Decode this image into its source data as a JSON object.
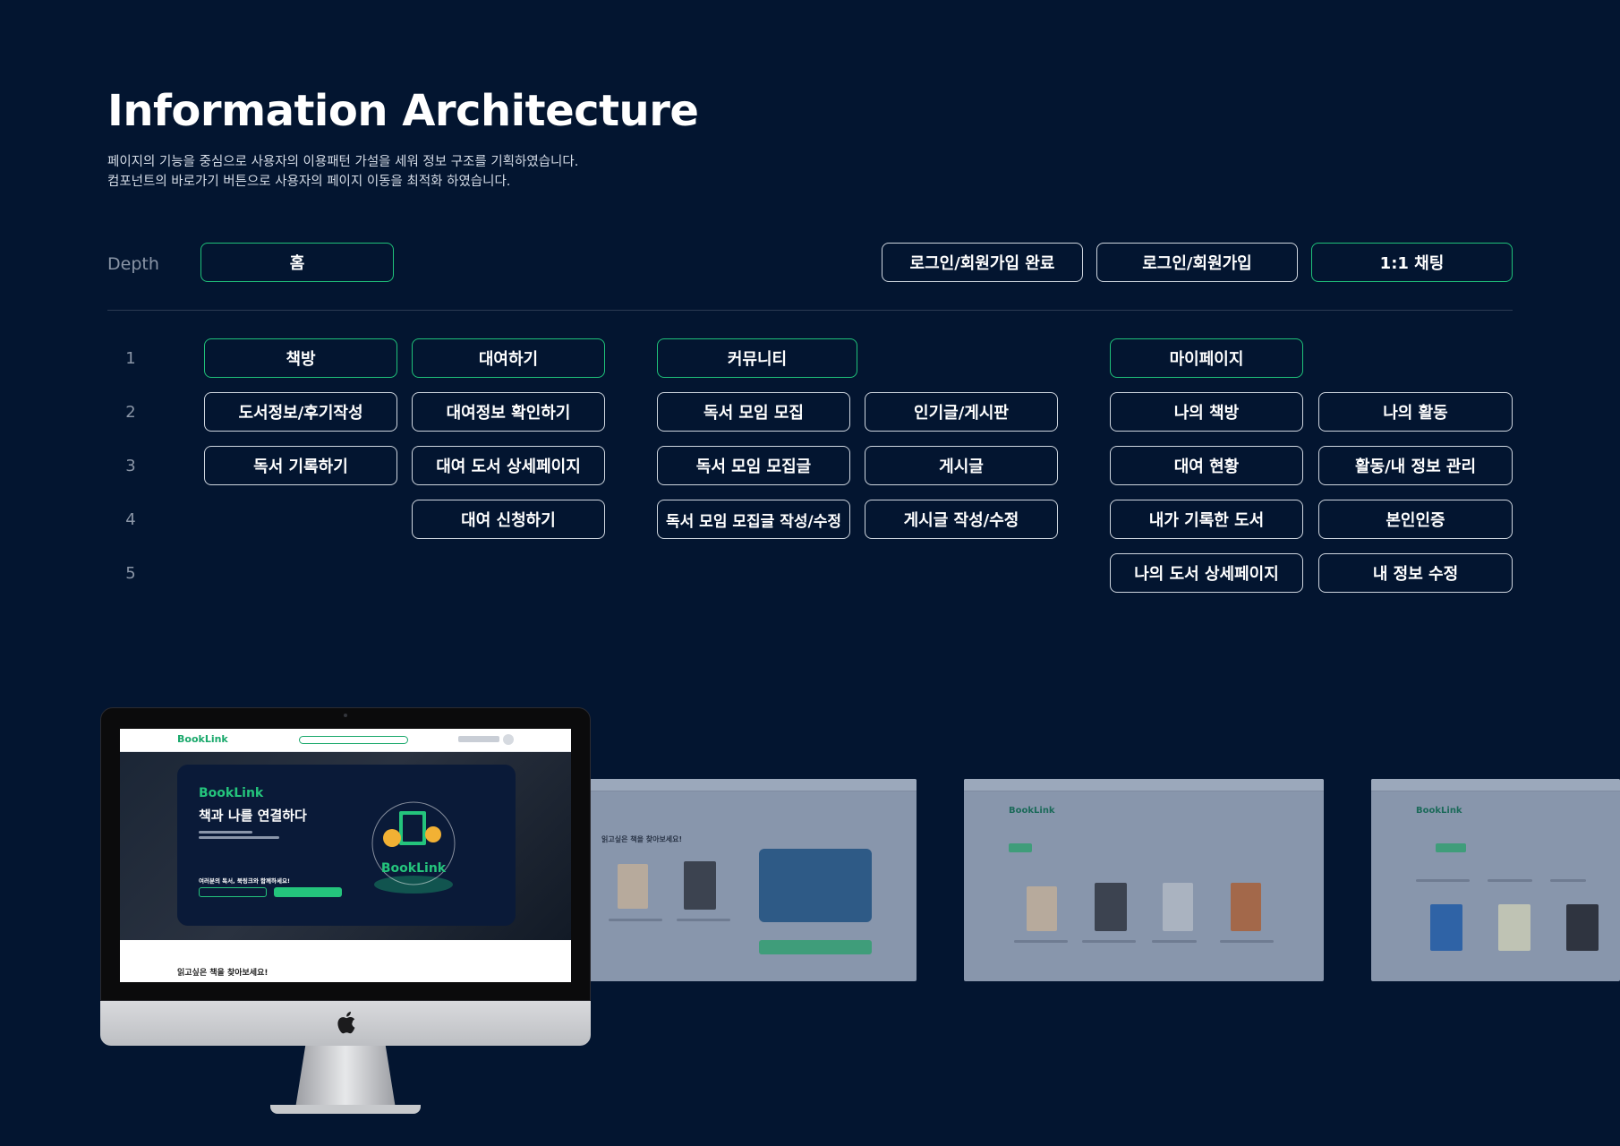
{
  "header": {
    "title": "Information Architecture",
    "desc_line1": "페이지의 기능을 중심으로 사용자의 이용패턴 가설을 세워 정보 구조를 기획하였습니다.",
    "desc_line2": "컴포넌트의 바로가기 버튼으로 사용자의 페이지 이동을 최적화 하였습니다."
  },
  "ia": {
    "depth_label": "Depth",
    "row_numbers": [
      "1",
      "2",
      "3",
      "4",
      "5"
    ],
    "home": "홈",
    "top_nodes": [
      "로그인/회원가입 완료",
      "로그인/회원가입",
      "1:1 채팅"
    ],
    "columns": [
      {
        "nodes": [
          "책방",
          "도서정보/후기작성",
          "독서 기록하기"
        ]
      },
      {
        "nodes": [
          "대여하기",
          "대여정보 확인하기",
          "대여 도서 상세페이지",
          "대여 신청하기"
        ]
      },
      {
        "nodes": [
          "커뮤니티",
          "독서 모임 모집",
          "독서 모임 모집글",
          "독서 모임 모집글 작성/수정"
        ]
      },
      {
        "nodes": [
          "인기글/게시판",
          "게시글",
          "게시글 작성/수정"
        ]
      },
      {
        "nodes": [
          "마이페이지",
          "나의 책방",
          "대여 현황",
          "내가 기록한 도서",
          "나의 도서 상세페이지"
        ]
      },
      {
        "nodes": [
          "나의 활동",
          "활동/내 정보 관리",
          "본인인증",
          "내 정보 수정"
        ]
      }
    ]
  },
  "mockup": {
    "nav_logo": "BookLink",
    "hero_logo": "BookLink",
    "hero_title": "책과 나를 연결하다",
    "hero_sub": "여러분의 독서, 북링크와 함께하세요!",
    "section_title": "읽고싶은 책을 찾아보세요!",
    "shot1_title": "읽고싶은 책을 찾아보세요!",
    "shot2_logo": "BookLink",
    "shot3_logo": "BookLink"
  },
  "colors": {
    "background": "#031530",
    "accent_green": "#1fc27a",
    "node_border": "#cfd6df"
  }
}
